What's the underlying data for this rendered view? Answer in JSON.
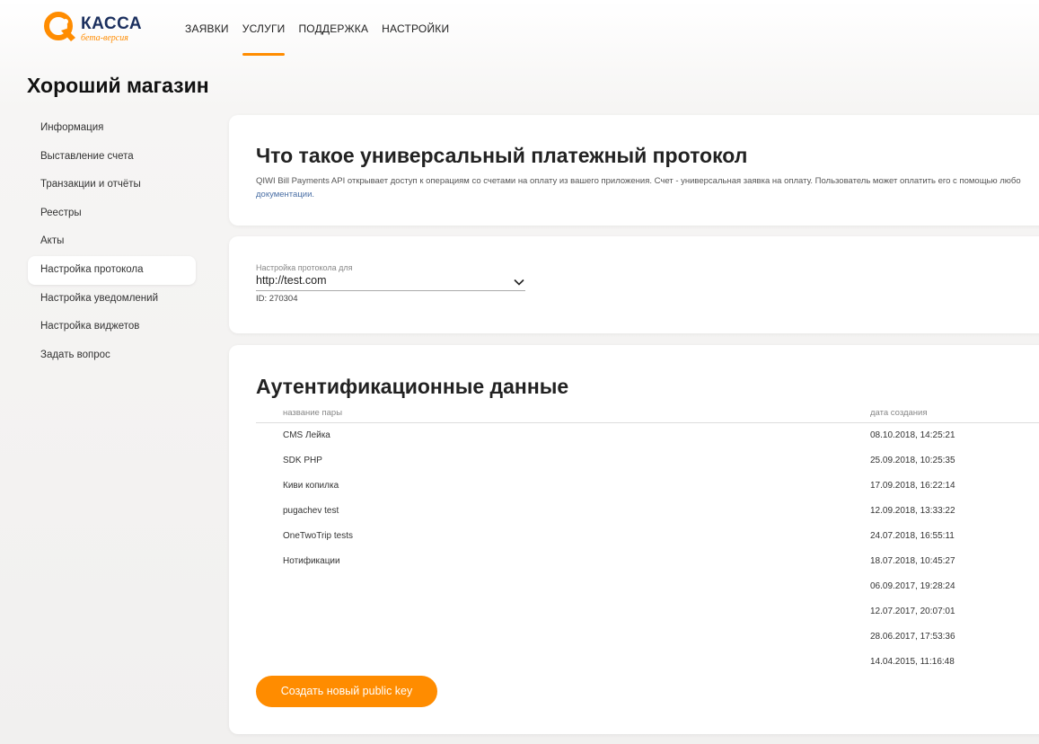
{
  "logo": {
    "name": "КАССА",
    "sub": "бета-версия"
  },
  "topnav": [
    {
      "label": "Заявки",
      "active": false
    },
    {
      "label": "Услуги",
      "active": true
    },
    {
      "label": "Поддержка",
      "active": false
    },
    {
      "label": "Настройки",
      "active": false
    }
  ],
  "shop_title": "Хороший магазин",
  "sidebar": [
    {
      "label": "Информация",
      "active": false
    },
    {
      "label": "Выставление счета",
      "active": false
    },
    {
      "label": "Транзакции и отчёты",
      "active": false
    },
    {
      "label": "Реестры",
      "active": false
    },
    {
      "label": "Акты",
      "active": false
    },
    {
      "label": "Настройка протокола",
      "active": true
    },
    {
      "label": "Настройка уведомлений",
      "active": false
    },
    {
      "label": "Настройка виджетов",
      "active": false
    },
    {
      "label": "Задать вопрос",
      "active": false
    }
  ],
  "intro": {
    "title": "Что такое универсальный платежный протокол",
    "text": "QIWI Bill Payments API открывает доступ к операциям со счетами на оплату из вашего приложения. Счет - универсальная заявка на оплату. Пользователь может оплатить его с помощью любо",
    "link": "документации."
  },
  "protocol": {
    "label": "Настройка протокола для",
    "value": "http://test.com",
    "id_text": "ID: 270304"
  },
  "auth": {
    "title": "Аутентификационные данные",
    "col_name": "название пары",
    "col_date": "дата создания",
    "rows": [
      {
        "name": "CMS Лейка",
        "date": "08.10.2018, 14:25:21"
      },
      {
        "name": "SDK PHP",
        "date": "25.09.2018, 10:25:35"
      },
      {
        "name": "Киви копилка",
        "date": "17.09.2018, 16:22:14"
      },
      {
        "name": "pugachev test",
        "date": "12.09.2018, 13:33:22"
      },
      {
        "name": "OneTwoTrip tests",
        "date": "24.07.2018, 16:55:11"
      },
      {
        "name": "Нотификации",
        "date": "18.07.2018, 10:45:27"
      },
      {
        "name": "",
        "date": "06.09.2017, 19:28:24"
      },
      {
        "name": "",
        "date": "12.07.2017, 20:07:01"
      },
      {
        "name": "",
        "date": "28.06.2017, 17:53:36"
      },
      {
        "name": "",
        "date": "14.04.2015, 11:16:48"
      }
    ],
    "create_button": "Создать новый public key"
  },
  "colors": {
    "accent": "#ff8c00",
    "brand": "#1b2f5e",
    "link": "#4a6fa5"
  },
  "icons": {
    "logo": "qiwi-logo-icon",
    "select": "chevron-down-icon"
  }
}
